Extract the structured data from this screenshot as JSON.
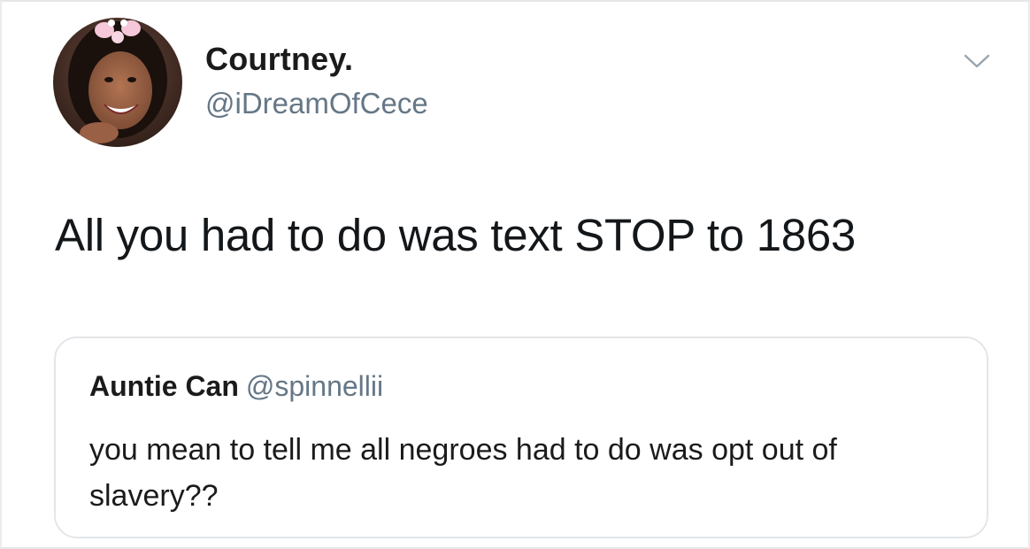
{
  "tweet": {
    "author_name": "Courtney.",
    "author_handle": "@iDreamOfCece",
    "text": "All you had to do was text STOP to 1863",
    "menu_icon": "chevron-down-icon",
    "avatar_icon": "avatar"
  },
  "quoted_tweet": {
    "author_name": "Auntie Can",
    "author_handle": "@spinnellii",
    "text": "you mean to tell me all negroes had to do was opt out of slavery??"
  },
  "colors": {
    "text": "#14171a",
    "secondary": "#657786",
    "border": "#e3e6e9"
  }
}
